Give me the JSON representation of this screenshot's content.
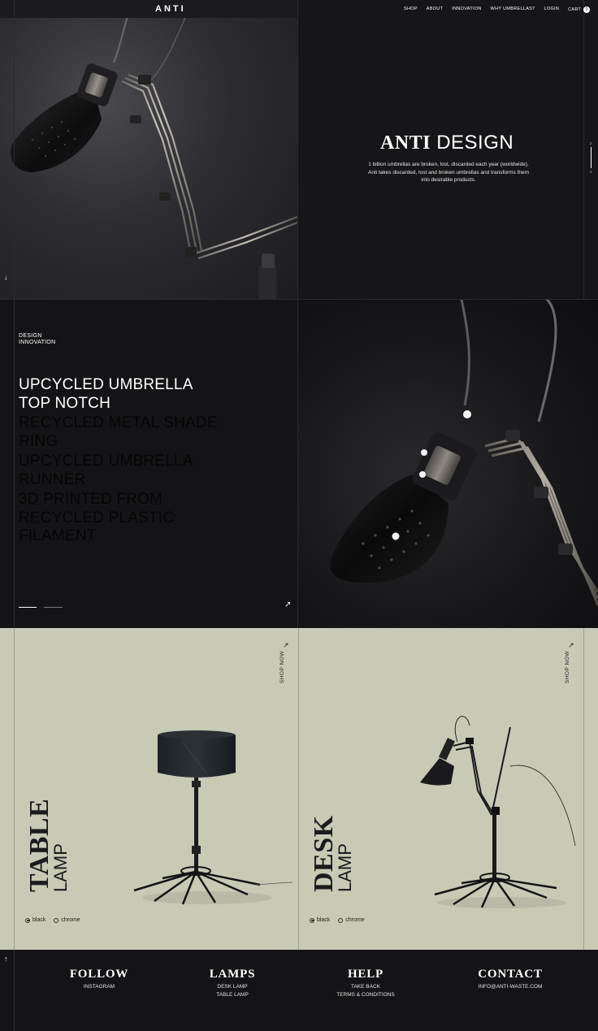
{
  "header": {
    "logo": "ANTI",
    "nav": [
      "SHOP",
      "ABOUT",
      "INNOVATION",
      "WHY UMBRELLAS?",
      "LOGIN"
    ],
    "cart_label": "CART",
    "cart_count": "0"
  },
  "hero": {
    "title_serif": "ANTI",
    "title_sans": "DESIGN",
    "description_line1": "1 billion umbrellas are broken, lost, discarded each year (worldwide).",
    "description_line2": "Anti takes discarded, lost and broken umbrellas and transforms them",
    "description_line3": "into desirable products.",
    "pager_top": "2",
    "pager_bottom": "4",
    "scroll_arrow": "↓"
  },
  "features": {
    "tag_line1": "DESIGN",
    "tag_line2": "INNOVATION",
    "items": [
      {
        "line1": "UPCYCLED UMBRELLA",
        "line2": "TOP NOTCH"
      },
      {
        "line1": "RECYCLED METAL SHADE",
        "line2": "RING"
      },
      {
        "line1": "UPCYCLED UMBRELLA",
        "line2": "RUNNER"
      },
      {
        "line1": "3D PRINTED FROM",
        "line2": "RECYCLED PLASTIC",
        "line3": "FILAMENT"
      }
    ],
    "link_arrow": "↗"
  },
  "products": [
    {
      "name_serif": "TABLE",
      "name_sans": "LAMP",
      "shop_line1": "SHOP",
      "shop_line2": "NOW",
      "shop_arrow": "↗",
      "colors": [
        "black",
        "chrome"
      ],
      "selected": "black"
    },
    {
      "name_serif": "DESK",
      "name_sans": "LAMP",
      "shop_line1": "SHOP",
      "shop_line2": "NOW",
      "shop_arrow": "↗",
      "colors": [
        "black",
        "chrome"
      ],
      "selected": "black"
    }
  ],
  "footer": {
    "back_to_top": "↑",
    "columns": [
      {
        "heading": "FOLLOW",
        "links": [
          "INSTAGRAM"
        ]
      },
      {
        "heading": "LAMPS",
        "links": [
          "DESK LAMP",
          "TABLE LAMP"
        ]
      },
      {
        "heading": "HELP",
        "links": [
          "TAKE BACK",
          "TERMS & CONDITIONS"
        ]
      },
      {
        "heading": "CONTACT",
        "links": [
          "INFO@ANTI-WASTE.COM"
        ]
      }
    ]
  },
  "colors": {
    "dark": "#141416",
    "sage": "#c8cab6",
    "text_light": "#ffffff"
  }
}
